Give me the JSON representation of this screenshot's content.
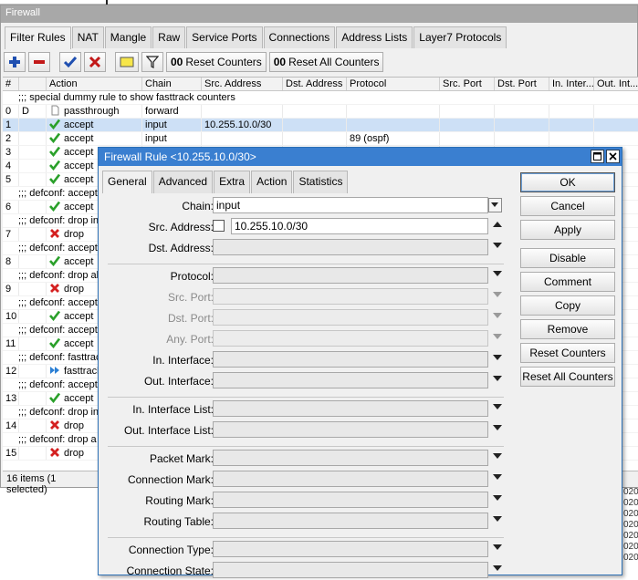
{
  "window": {
    "title": "Firewall"
  },
  "tabs": [
    "Filter Rules",
    "NAT",
    "Mangle",
    "Raw",
    "Service Ports",
    "Connections",
    "Address Lists",
    "Layer7 Protocols"
  ],
  "toolbar": {
    "reset_counters": "Reset Counters",
    "reset_all_counters": "Reset All Counters",
    "counter_prefix": "00"
  },
  "grid": {
    "columns": [
      "#",
      "Action",
      "Chain",
      "Src. Address",
      "Dst. Address",
      "Protocol",
      "Src. Port",
      "Dst. Port",
      "In. Inter...",
      "Out. Int..."
    ],
    "rows": [
      {
        "type": "comment",
        "text": ";;; special dummy rule to show fasttrack counters"
      },
      {
        "num": "0",
        "flag": "D",
        "icon": "passthrough-icon",
        "action": "passthrough",
        "chain": "forward",
        "src": "",
        "proto": ""
      },
      {
        "num": "1",
        "icon": "accept-icon",
        "action": "accept",
        "chain": "input",
        "src": "10.255.10.0/30",
        "proto": "",
        "selected": true
      },
      {
        "num": "2",
        "icon": "accept-icon",
        "action": "accept",
        "chain": "input",
        "src": "",
        "proto": "89 (ospf)"
      },
      {
        "num": "3",
        "icon": "accept-icon",
        "action": "accept"
      },
      {
        "num": "4",
        "icon": "accept-icon",
        "action": "accept"
      },
      {
        "num": "5",
        "icon": "accept-icon",
        "action": "accept"
      },
      {
        "type": "comment",
        "text": ";;; defconf: accept"
      },
      {
        "num": "6",
        "icon": "accept-icon",
        "action": "accept"
      },
      {
        "type": "comment",
        "text": ";;; defconf: drop in"
      },
      {
        "num": "7",
        "icon": "drop-icon",
        "action": "drop"
      },
      {
        "type": "comment",
        "text": ";;; defconf: accept"
      },
      {
        "num": "8",
        "icon": "accept-icon",
        "action": "accept"
      },
      {
        "type": "comment",
        "text": ";;; defconf: drop all"
      },
      {
        "num": "9",
        "icon": "drop-icon",
        "action": "drop"
      },
      {
        "type": "comment",
        "text": ";;; defconf: accept"
      },
      {
        "num": "10",
        "icon": "accept-icon",
        "action": "accept"
      },
      {
        "type": "comment",
        "text": ";;; defconf: accept"
      },
      {
        "num": "11",
        "icon": "accept-icon",
        "action": "accept"
      },
      {
        "type": "comment",
        "text": ";;; defconf: fasttrac"
      },
      {
        "num": "12",
        "icon": "fasttrack-icon",
        "action": "fasttrack"
      },
      {
        "type": "comment",
        "text": ";;; defconf: accept"
      },
      {
        "num": "13",
        "icon": "accept-icon",
        "action": "accept"
      },
      {
        "type": "comment",
        "text": ";;; defconf: drop in"
      },
      {
        "num": "14",
        "icon": "drop-icon",
        "action": "drop"
      },
      {
        "type": "comment",
        "text": ";;; defconf:  drop a"
      },
      {
        "num": "15",
        "icon": "drop-icon",
        "action": "drop"
      }
    ]
  },
  "status": {
    "text": "16 items (1 selected)"
  },
  "right_edge": [
    "020",
    "020",
    "020",
    "020",
    "020",
    "020",
    "020"
  ],
  "dialog": {
    "title": "Firewall Rule <10.255.10.0/30>",
    "tabs": [
      "General",
      "Advanced",
      "Extra",
      "Action",
      "Statistics"
    ],
    "fields": {
      "chain": {
        "label": "Chain:",
        "value": "input"
      },
      "src_address": {
        "label": "Src. Address:",
        "value": "10.255.10.0/30"
      },
      "dst_address": {
        "label": "Dst. Address:",
        "value": ""
      },
      "protocol": {
        "label": "Protocol:",
        "value": ""
      },
      "src_port": {
        "label": "Src. Port:",
        "value": ""
      },
      "dst_port": {
        "label": "Dst. Port:",
        "value": ""
      },
      "any_port": {
        "label": "Any. Port:",
        "value": ""
      },
      "in_interface": {
        "label": "In. Interface:",
        "value": ""
      },
      "out_interface": {
        "label": "Out. Interface:",
        "value": ""
      },
      "in_interface_list": {
        "label": "In. Interface List:",
        "value": ""
      },
      "out_interface_list": {
        "label": "Out. Interface List:",
        "value": ""
      },
      "packet_mark": {
        "label": "Packet Mark:",
        "value": ""
      },
      "connection_mark": {
        "label": "Connection Mark:",
        "value": ""
      },
      "routing_mark": {
        "label": "Routing Mark:",
        "value": ""
      },
      "routing_table": {
        "label": "Routing Table:",
        "value": ""
      },
      "connection_type": {
        "label": "Connection Type:",
        "value": ""
      },
      "connection_state": {
        "label": "Connection State:",
        "value": ""
      }
    },
    "buttons": {
      "ok": "OK",
      "cancel": "Cancel",
      "apply": "Apply",
      "disable": "Disable",
      "comment": "Comment",
      "copy": "Copy",
      "remove": "Remove",
      "reset_counters": "Reset Counters",
      "reset_all_counters": "Reset All Counters"
    }
  },
  "colors": {
    "accept": "#2aa02a",
    "drop": "#d42020",
    "fasttrack": "#2b7fd4",
    "dialog_title": "#3a7fd0",
    "selection": "#cde0f6"
  }
}
